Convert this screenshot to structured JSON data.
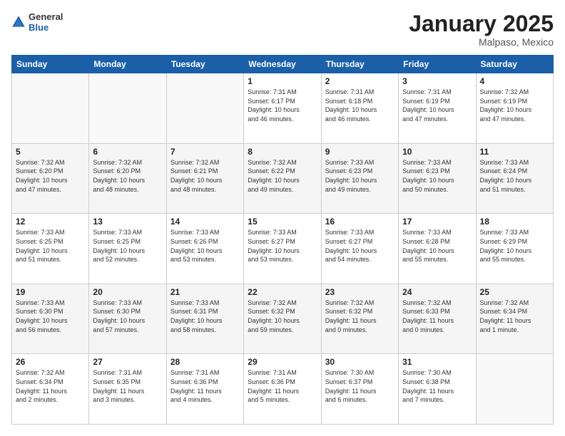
{
  "header": {
    "logo": {
      "general": "General",
      "blue": "Blue"
    },
    "title": "January 2025",
    "subtitle": "Malpaso, Mexico"
  },
  "days_of_week": [
    "Sunday",
    "Monday",
    "Tuesday",
    "Wednesday",
    "Thursday",
    "Friday",
    "Saturday"
  ],
  "weeks": [
    [
      {
        "day": "",
        "info": ""
      },
      {
        "day": "",
        "info": ""
      },
      {
        "day": "",
        "info": ""
      },
      {
        "day": "1",
        "info": "Sunrise: 7:31 AM\nSunset: 6:17 PM\nDaylight: 10 hours\nand 46 minutes."
      },
      {
        "day": "2",
        "info": "Sunrise: 7:31 AM\nSunset: 6:18 PM\nDaylight: 10 hours\nand 46 minutes."
      },
      {
        "day": "3",
        "info": "Sunrise: 7:31 AM\nSunset: 6:19 PM\nDaylight: 10 hours\nand 47 minutes."
      },
      {
        "day": "4",
        "info": "Sunrise: 7:32 AM\nSunset: 6:19 PM\nDaylight: 10 hours\nand 47 minutes."
      }
    ],
    [
      {
        "day": "5",
        "info": "Sunrise: 7:32 AM\nSunset: 6:20 PM\nDaylight: 10 hours\nand 47 minutes."
      },
      {
        "day": "6",
        "info": "Sunrise: 7:32 AM\nSunset: 6:20 PM\nDaylight: 10 hours\nand 48 minutes."
      },
      {
        "day": "7",
        "info": "Sunrise: 7:32 AM\nSunset: 6:21 PM\nDaylight: 10 hours\nand 48 minutes."
      },
      {
        "day": "8",
        "info": "Sunrise: 7:32 AM\nSunset: 6:22 PM\nDaylight: 10 hours\nand 49 minutes."
      },
      {
        "day": "9",
        "info": "Sunrise: 7:33 AM\nSunset: 6:23 PM\nDaylight: 10 hours\nand 49 minutes."
      },
      {
        "day": "10",
        "info": "Sunrise: 7:33 AM\nSunset: 6:23 PM\nDaylight: 10 hours\nand 50 minutes."
      },
      {
        "day": "11",
        "info": "Sunrise: 7:33 AM\nSunset: 6:24 PM\nDaylight: 10 hours\nand 51 minutes."
      }
    ],
    [
      {
        "day": "12",
        "info": "Sunrise: 7:33 AM\nSunset: 6:25 PM\nDaylight: 10 hours\nand 51 minutes."
      },
      {
        "day": "13",
        "info": "Sunrise: 7:33 AM\nSunset: 6:25 PM\nDaylight: 10 hours\nand 52 minutes."
      },
      {
        "day": "14",
        "info": "Sunrise: 7:33 AM\nSunset: 6:26 PM\nDaylight: 10 hours\nand 53 minutes."
      },
      {
        "day": "15",
        "info": "Sunrise: 7:33 AM\nSunset: 6:27 PM\nDaylight: 10 hours\nand 53 minutes."
      },
      {
        "day": "16",
        "info": "Sunrise: 7:33 AM\nSunset: 6:27 PM\nDaylight: 10 hours\nand 54 minutes."
      },
      {
        "day": "17",
        "info": "Sunrise: 7:33 AM\nSunset: 6:28 PM\nDaylight: 10 hours\nand 55 minutes."
      },
      {
        "day": "18",
        "info": "Sunrise: 7:33 AM\nSunset: 6:29 PM\nDaylight: 10 hours\nand 55 minutes."
      }
    ],
    [
      {
        "day": "19",
        "info": "Sunrise: 7:33 AM\nSunset: 6:30 PM\nDaylight: 10 hours\nand 56 minutes."
      },
      {
        "day": "20",
        "info": "Sunrise: 7:33 AM\nSunset: 6:30 PM\nDaylight: 10 hours\nand 57 minutes."
      },
      {
        "day": "21",
        "info": "Sunrise: 7:33 AM\nSunset: 6:31 PM\nDaylight: 10 hours\nand 58 minutes."
      },
      {
        "day": "22",
        "info": "Sunrise: 7:32 AM\nSunset: 6:32 PM\nDaylight: 10 hours\nand 59 minutes."
      },
      {
        "day": "23",
        "info": "Sunrise: 7:32 AM\nSunset: 6:32 PM\nDaylight: 11 hours\nand 0 minutes."
      },
      {
        "day": "24",
        "info": "Sunrise: 7:32 AM\nSunset: 6:33 PM\nDaylight: 11 hours\nand 0 minutes."
      },
      {
        "day": "25",
        "info": "Sunrise: 7:32 AM\nSunset: 6:34 PM\nDaylight: 11 hours\nand 1 minute."
      }
    ],
    [
      {
        "day": "26",
        "info": "Sunrise: 7:32 AM\nSunset: 6:34 PM\nDaylight: 11 hours\nand 2 minutes."
      },
      {
        "day": "27",
        "info": "Sunrise: 7:31 AM\nSunset: 6:35 PM\nDaylight: 11 hours\nand 3 minutes."
      },
      {
        "day": "28",
        "info": "Sunrise: 7:31 AM\nSunset: 6:36 PM\nDaylight: 11 hours\nand 4 minutes."
      },
      {
        "day": "29",
        "info": "Sunrise: 7:31 AM\nSunset: 6:36 PM\nDaylight: 11 hours\nand 5 minutes."
      },
      {
        "day": "30",
        "info": "Sunrise: 7:30 AM\nSunset: 6:37 PM\nDaylight: 11 hours\nand 6 minutes."
      },
      {
        "day": "31",
        "info": "Sunrise: 7:30 AM\nSunset: 6:38 PM\nDaylight: 11 hours\nand 7 minutes."
      },
      {
        "day": "",
        "info": ""
      }
    ]
  ]
}
